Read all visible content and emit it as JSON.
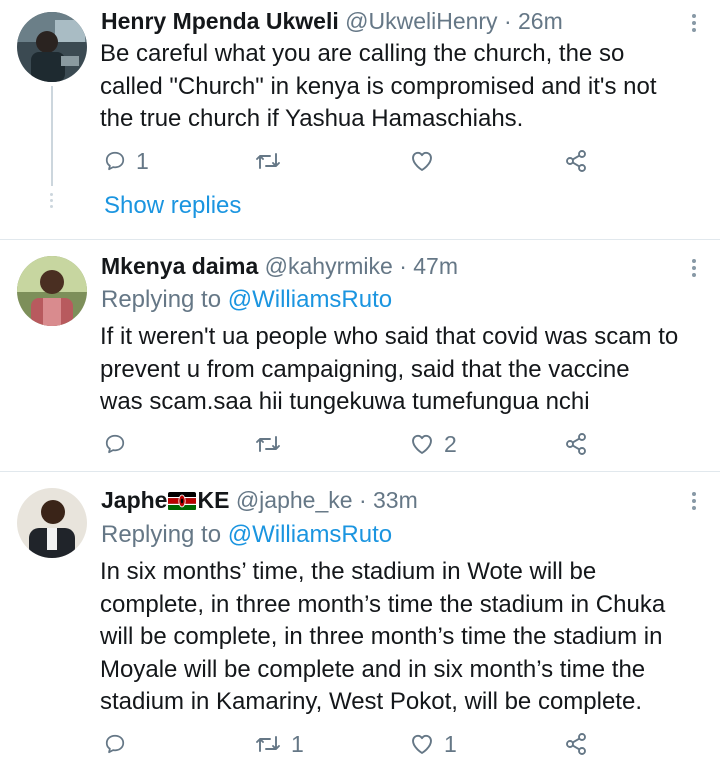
{
  "tweets": [
    {
      "name": "Henry Mpenda Ukweli",
      "handle": "@UkweliHenry",
      "dot": "·",
      "time": "26m",
      "replying_prefix": "",
      "replying_to": "",
      "lines": [
        "Be careful what you are calling the church, the so",
        "called \"Church\" in kenya is compromised and it's not",
        "the true church if Yashua Hamaschiahs."
      ],
      "reply_count": "1",
      "retweet_count": "",
      "like_count": "",
      "show_replies": "Show replies"
    },
    {
      "name": "Mkenya daima",
      "handle": "@kahyrmike",
      "dot": "·",
      "time": "47m",
      "replying_prefix": "Replying to ",
      "replying_to": "@WilliamsRuto",
      "lines": [
        "If it weren't ua people who said that covid was scam to",
        "prevent u from campaigning,  said that the vaccine",
        "was scam.saa hii tungekuwa tumefungua nchi"
      ],
      "reply_count": "",
      "retweet_count": "",
      "like_count": "2"
    },
    {
      "name_prefix": "Japhe",
      "name_suffix": "KE",
      "handle": "@japhe_ke",
      "dot": "·",
      "time": "33m",
      "replying_prefix": "Replying to ",
      "replying_to": "@WilliamsRuto",
      "lines": [
        "In six months’ time, the stadium in Wote will be",
        "complete, in three month’s time the stadium in Chuka",
        "will be complete, in three month’s time the stadium in",
        "Moyale will be complete and in six month’s time the",
        "stadium in Kamariny, West Pokot, will be complete."
      ],
      "reply_count": "",
      "retweet_count": "1",
      "like_count": "1"
    }
  ],
  "icons": {
    "reply": "reply-icon",
    "retweet": "retweet-icon",
    "like": "like-icon",
    "share": "share-icon",
    "more": "more-options-icon",
    "flag": "kenya-flag-icon"
  },
  "colors": {
    "link": "#1b95e0",
    "secondary_text": "#657786",
    "icon": "#657786",
    "separator": "#e1e8ed"
  }
}
